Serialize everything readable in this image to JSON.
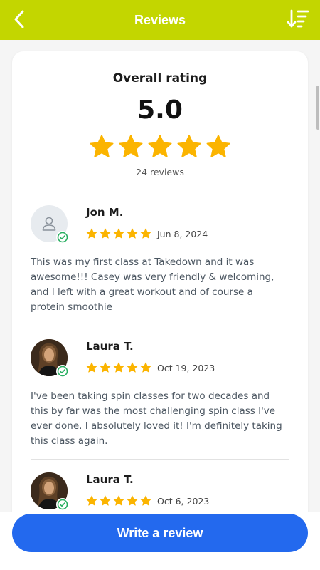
{
  "header": {
    "title": "Reviews",
    "back_icon": "chevron-left-icon",
    "sort_icon": "sort-descending-icon",
    "color": "#c3d600"
  },
  "overall": {
    "title": "Overall rating",
    "value": "5.0",
    "stars": 5,
    "count_text": "24 reviews",
    "star_color": "#fbb400"
  },
  "reviews": [
    {
      "name": "Jon M.",
      "date": "Jun 8, 2024",
      "stars": 5,
      "avatar": "user-placeholder-icon",
      "verified": true,
      "text": "This was my first class at Takedown and it was awesome!!! Casey was very friendly & welcoming, and I left with a great workout and of course a protein smoothie"
    },
    {
      "name": "Laura T.",
      "date": "Oct 19, 2023",
      "stars": 5,
      "avatar": "profile-photo",
      "verified": true,
      "text": "I've been taking spin classes for two decades and this by far was the most challenging spin class I've ever done. I absolutely loved it! I'm definitely taking this class again."
    },
    {
      "name": "Laura T.",
      "date": "Oct 6, 2023",
      "stars": 5,
      "avatar": "profile-photo",
      "verified": true,
      "text": ""
    }
  ],
  "footer": {
    "write_review_label": "Write a review",
    "button_color": "#2369ee"
  }
}
